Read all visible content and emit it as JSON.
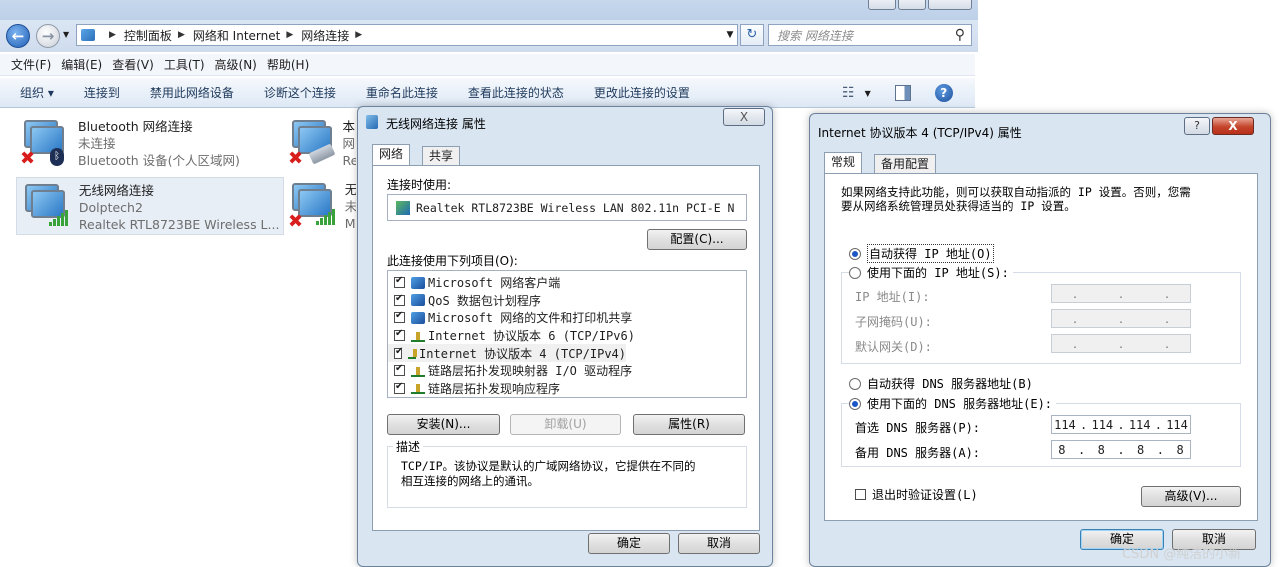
{
  "explorer": {
    "address": {
      "crumbs": [
        "控制面板",
        "网络和 Internet",
        "网络连接"
      ],
      "search_placeholder": "搜索 网络连接"
    },
    "menu": [
      "文件(F)",
      "编辑(E)",
      "查看(V)",
      "工具(T)",
      "高级(N)",
      "帮助(H)"
    ],
    "commands": [
      "组织 ▾",
      "连接到",
      "禁用此网络设备",
      "诊断这个连接",
      "重命名此连接",
      "查看此连接的状态",
      "更改此连接的设置"
    ],
    "connections": [
      {
        "name": "Bluetooth 网络连接",
        "status": "未连接",
        "device": "Bluetooth 设备(个人区域网)"
      },
      {
        "name": "无线网络连接",
        "status": "Dolptech2",
        "device": "Realtek RTL8723BE Wireless L..."
      },
      {
        "name": "本",
        "status": "网",
        "device": "Re"
      },
      {
        "name": "无",
        "status": "未",
        "device": "M"
      }
    ]
  },
  "wifi_props": {
    "title": "无线网络连接 属性",
    "tabs": [
      "网络",
      "共享"
    ],
    "connect_using_label": "连接时使用:",
    "adapter": "Realtek RTL8723BE Wireless LAN 802.11n PCI-E N",
    "configure_btn": "配置(C)...",
    "items_label": "此连接使用下列项目(O):",
    "items": [
      {
        "label": "Microsoft 网络客户端",
        "icon": "client-icon"
      },
      {
        "label": "QoS 数据包计划程序",
        "icon": "client-icon"
      },
      {
        "label": "Microsoft 网络的文件和打印机共享",
        "icon": "client-icon"
      },
      {
        "label": "Internet 协议版本 6 (TCP/IPv6)",
        "icon": "protocol-icon"
      },
      {
        "label": "Internet 协议版本 4 (TCP/IPv4)",
        "icon": "protocol-icon"
      },
      {
        "label": "链路层拓扑发现映射器 I/O 驱动程序",
        "icon": "protocol-icon"
      },
      {
        "label": "链路层拓扑发现响应程序",
        "icon": "protocol-icon"
      }
    ],
    "install_btn": "安装(N)...",
    "uninstall_btn": "卸载(U)",
    "properties_btn": "属性(R)",
    "desc_label": "描述",
    "desc_text_1": "TCP/IP。该协议是默认的广域网络协议，它提供在不同的",
    "desc_text_2": "相互连接的网络上的通讯。",
    "ok_btn": "确定",
    "cancel_btn": "取消",
    "close_glyph": "X"
  },
  "ipv4_props": {
    "title": "Internet 协议版本 4 (TCP/IPv4) 属性",
    "tabs": [
      "常规",
      "备用配置"
    ],
    "intro_1": "如果网络支持此功能，则可以获取自动指派的 IP 设置。否则，您需",
    "intro_2": "要从网络系统管理员处获得适当的 IP 设置。",
    "auto_ip": "自动获得 IP 地址(O)",
    "manual_ip": "使用下面的 IP 地址(S):",
    "ip_label": "IP 地址(I):",
    "mask_label": "子网掩码(U):",
    "gateway_label": "默认网关(D):",
    "auto_dns": "自动获得 DNS 服务器地址(B)",
    "manual_dns": "使用下面的 DNS 服务器地址(E):",
    "pref_dns_label": "首选 DNS 服务器(P):",
    "pref_dns": [
      "114",
      "114",
      "114",
      "114"
    ],
    "alt_dns_label": "备用 DNS 服务器(A):",
    "alt_dns": [
      "8",
      "8",
      "8",
      "8"
    ],
    "validate_label": "退出时验证设置(L)",
    "advanced_btn": "高级(V)...",
    "ok_btn": "确定",
    "cancel_btn": "取消",
    "help_glyph": "?",
    "close_glyph": "X"
  },
  "watermark": "CSDN @纯洁的小新"
}
